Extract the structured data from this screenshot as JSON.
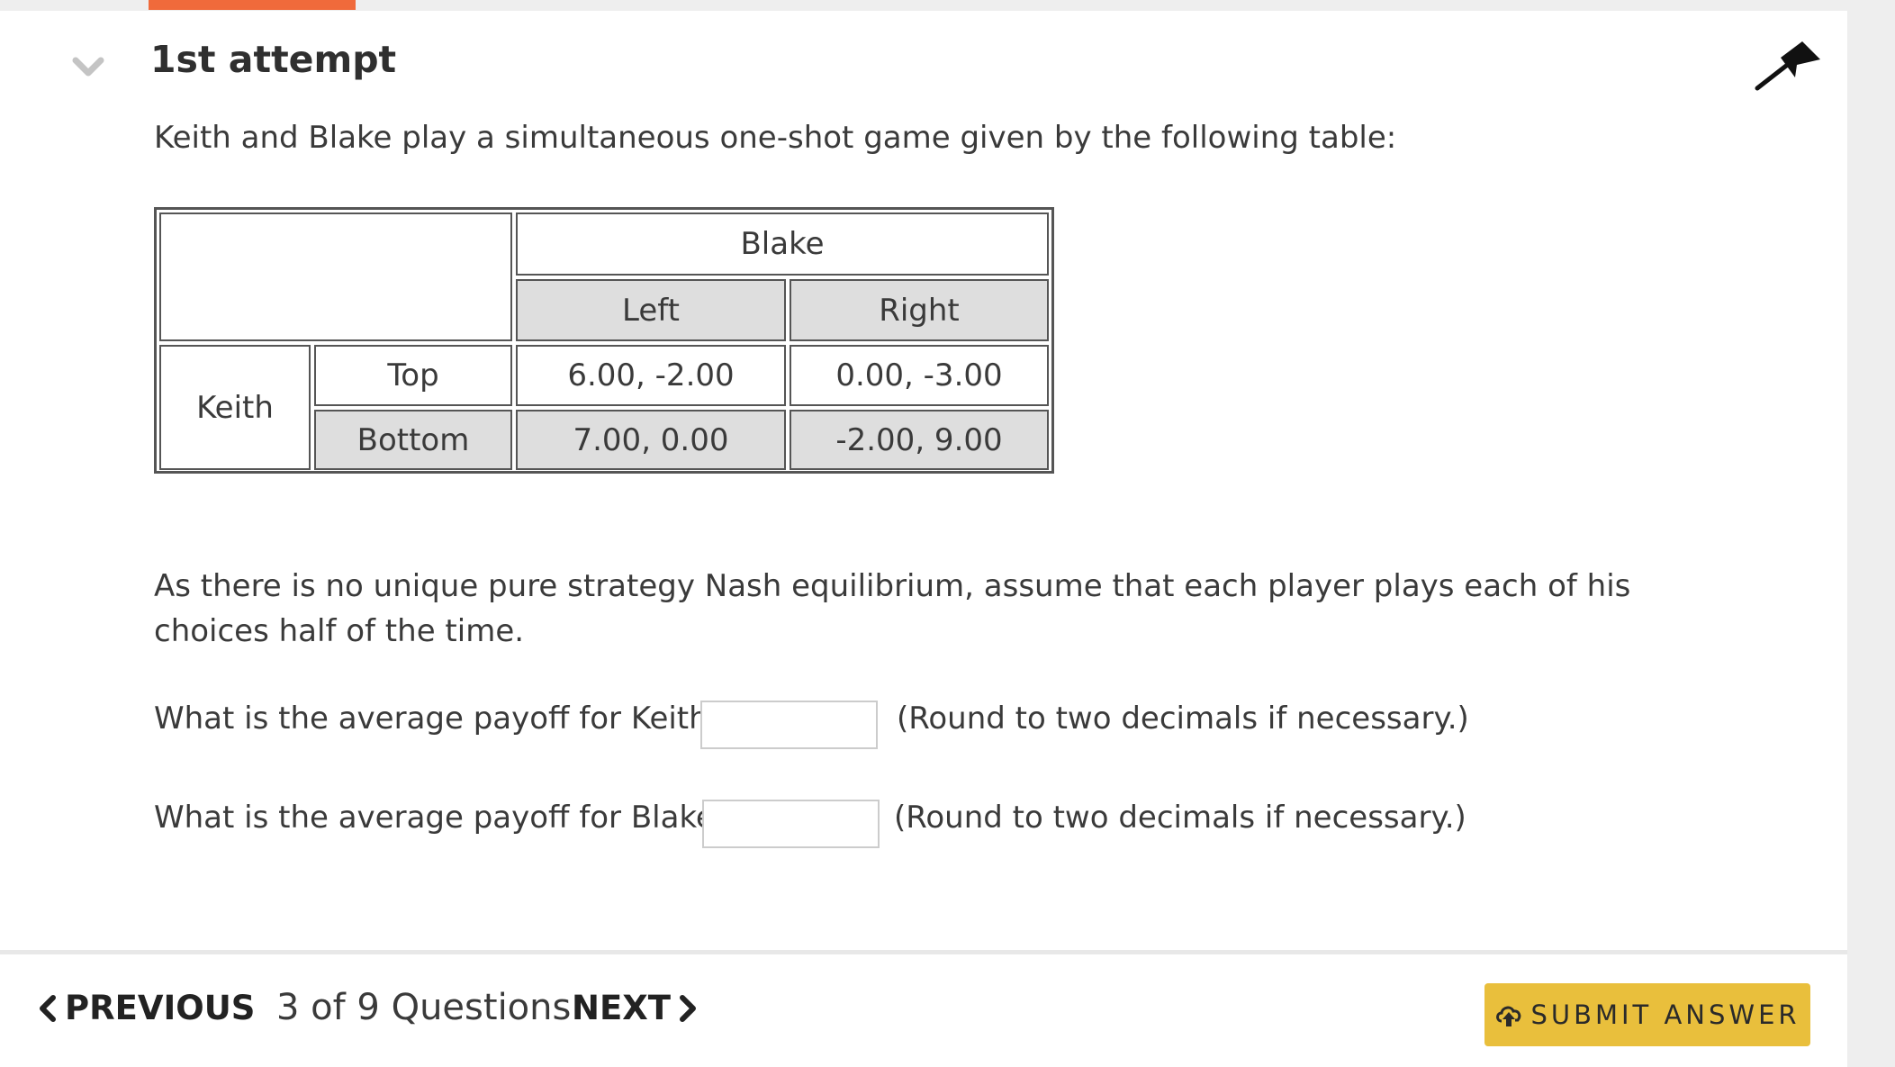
{
  "attempt": {
    "title": "1st attempt"
  },
  "question": {
    "prompt": "Keith and Blake play a simultaneous one-shot game given by the following table:",
    "table": {
      "col_player": "Blake",
      "row_player": "Keith",
      "col_labels": [
        "Left",
        "Right"
      ],
      "row_labels": [
        "Top",
        "Bottom"
      ],
      "cells": [
        [
          "6.00, -2.00",
          "0.00, -3.00"
        ],
        [
          "7.00, 0.00",
          "-2.00, 9.00"
        ]
      ]
    },
    "note": "As there is no unique pure strategy Nash equilibrium, assume that each player plays each of his choices half of the time.",
    "items": [
      {
        "label": "What is the average payoff for Keith?",
        "value": "",
        "hint": "(Round to two decimals if necessary.)"
      },
      {
        "label": "What is the average payoff for Blake?",
        "value": "",
        "hint": "(Round to two decimals if necessary.)"
      }
    ]
  },
  "nav": {
    "previous_label": "PREVIOUS",
    "counter": "3 of 9 Questions",
    "next_label": "NEXT",
    "submit_label": "SUBMIT ANSWER"
  },
  "icons": {
    "collapse": "chevron-down-icon",
    "flag": "flag-icon",
    "previous": "chevron-left-icon",
    "next": "chevron-right-icon",
    "submit": "cloud-upload-icon"
  },
  "colors": {
    "accent": "#f06a3b",
    "submit_bg": "#e9bf3c",
    "header_cell_bg": "#dedede"
  }
}
